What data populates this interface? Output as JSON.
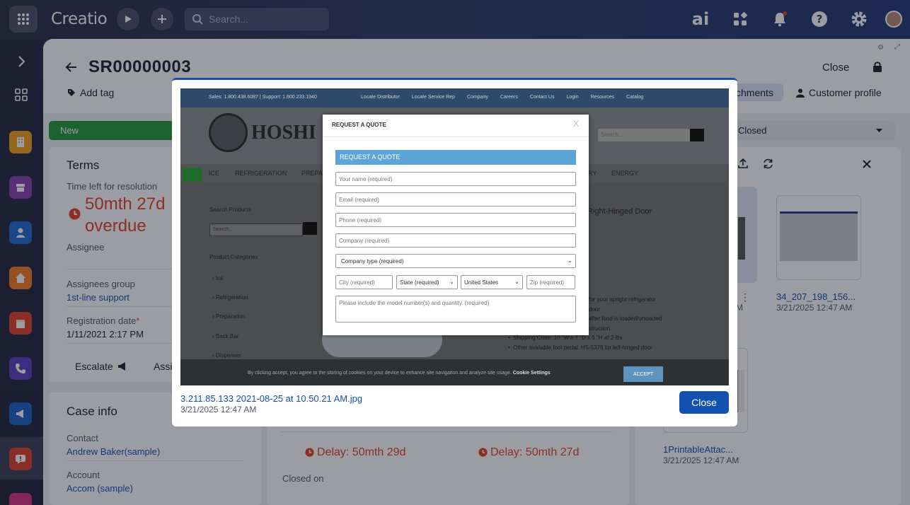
{
  "topbar": {
    "logo": "Creatio",
    "search_placeholder": "Search...",
    "ai_label": "ai"
  },
  "header": {
    "title": "SR00000003",
    "close_label": "Close",
    "add_tag": "Add tag",
    "attachments_tab": "chments",
    "customer_profile": "Customer profile"
  },
  "progress": {
    "stage_new": "New",
    "stage_closed": "Closed"
  },
  "terms": {
    "heading": "Terms",
    "time_left_label": "Time left for resolution",
    "time_left_value": "50mth 27d",
    "overdue": "overdue",
    "assignee_label": "Assignee",
    "assignees_group_label": "Assignees group",
    "assignees_group_value": "1st-line support",
    "registration_date_label": "Registration date",
    "registration_required_mark": "*",
    "registration_date_value": "1/11/2021 2:17 PM",
    "escalate_label": "Escalate",
    "assign_label": "Assi"
  },
  "case_info": {
    "heading": "Case info",
    "contact_label": "Contact",
    "contact_value": "Andrew Baker(sample)",
    "account_label": "Account",
    "account_value": "Accom (sample)"
  },
  "middle": {
    "delay_1": "Delay: 50mth 29d",
    "delay_2": "Delay: 50mth 27d",
    "closed_on": "Closed on"
  },
  "attachments": {
    "file_1_name": "34_207_198_156...",
    "file_1_date": "3/21/2025 12:47 AM",
    "file_2_name": "1PrintableAttac...",
    "file_2_date": "3/21/2025 12:47 AM",
    "partial_date_suffix": "M"
  },
  "viewer": {
    "file_name": "3.211.85.133 2021-08-25 at 10.50.21 AM.jpg",
    "file_date": "3/21/2025 12:47 AM",
    "close_label": "Close"
  },
  "screenshot": {
    "top_contact": "Sales: 1.800.438.6087 | Support: 1.800.233.1940",
    "top_links": [
      "Locate Distributor",
      "Locate Service Rep",
      "Company",
      "Careers",
      "Contact Us",
      "Login",
      "Resources",
      "Catalog"
    ],
    "brand": "HOSHI",
    "search_placeholder": "Search...",
    "menu": [
      "ICE",
      "REFRIGERATION",
      "PREPA",
      "RY",
      "ENERGY"
    ],
    "search_products": "Search Products",
    "product_categories": "Product Categories",
    "categories": [
      "Ice",
      "Refrigeration",
      "Preparation",
      "Back Bar",
      "Dispenser"
    ],
    "product_title": "Right-Hinged Door",
    "features": [
      "for your upright refrigerator",
      "door",
      "after food is loaded/unloaded",
      "struction",
      "Shipping Crate: 10 \"W x 7 \"D x 5 \"H at 2 lbs",
      "Other available foot pedal: HS-5378 for left-hinged door"
    ],
    "cookie_text": "By clicking accept, you agree to the storing of cookies on your device to enhance site navigation and analyze site usage.",
    "cookie_settings": "Cookie Settings",
    "accept": "ACCEPT",
    "quote": {
      "title": "REQUEST A QUOTE",
      "close_x": "X",
      "banner": "REQUEST A QUOTE",
      "name": "Your name (required)",
      "email": "Email (required)",
      "phone": "Phone (required)",
      "company": "Company (required)",
      "company_type": "Company type (required)",
      "city": "City (required)",
      "state": "State (required)",
      "country": "United States",
      "zip": "Zip (required)",
      "message": "Please include the model number(s) and quantity. (required)"
    }
  },
  "colors": {
    "primary": "#1351b0",
    "success": "#239b3a",
    "danger": "#e2412a"
  }
}
